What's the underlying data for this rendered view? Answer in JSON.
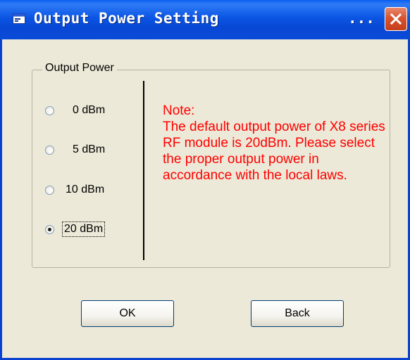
{
  "window": {
    "title": "Output Power Setting",
    "title_overflow": "...",
    "close_icon": "close-icon",
    "title_icon": "window-app-icon"
  },
  "group": {
    "label": "Output Power",
    "options": [
      {
        "label": "0 dBm",
        "checked": false
      },
      {
        "label": "5 dBm",
        "checked": false
      },
      {
        "label": "10 dBm",
        "checked": false
      },
      {
        "label": "20 dBm",
        "checked": true
      }
    ]
  },
  "note": {
    "text": "Note:\nThe default output power of X8 series RF module is 20dBm. Please select the proper output power in accordance with the local laws."
  },
  "buttons": {
    "ok": "OK",
    "back": "Back"
  },
  "colors": {
    "titlebar": "#0a4bd8",
    "window_bg": "#ece9d8",
    "note_text": "#ff0000",
    "close_button": "#d9532f"
  }
}
